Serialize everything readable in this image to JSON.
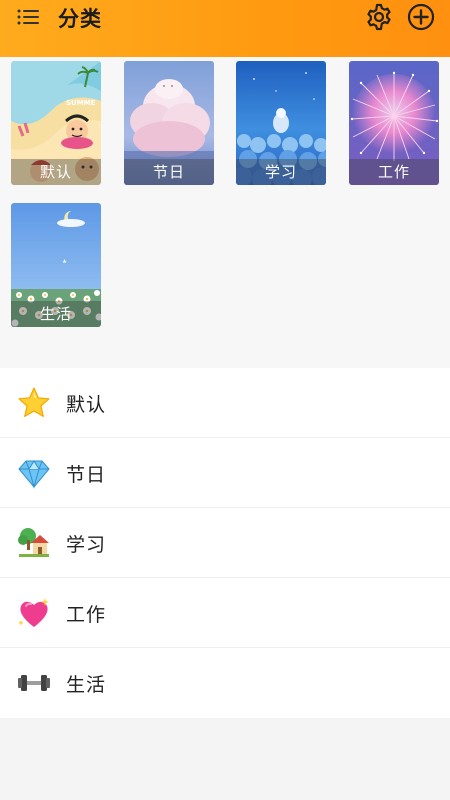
{
  "header": {
    "title": "分类",
    "menu_icon": "list-menu-icon",
    "settings_icon": "gear-icon",
    "add_icon": "plus-circle-icon",
    "background": "#ff9f14"
  },
  "categories": [
    {
      "name": "默认",
      "cover": "summer-beach-cartoon"
    },
    {
      "name": "节日",
      "cover": "pink-clouds-sky"
    },
    {
      "name": "学习",
      "cover": "blue-flowers-night"
    },
    {
      "name": "工作",
      "cover": "fireworks-purple"
    },
    {
      "name": "生活",
      "cover": "moon-daisy-field"
    }
  ],
  "list": [
    {
      "label": "默认",
      "icon": "star-icon"
    },
    {
      "label": "节日",
      "icon": "diamond-icon"
    },
    {
      "label": "学习",
      "icon": "house-with-tree-icon"
    },
    {
      "label": "工作",
      "icon": "sparkling-heart-icon"
    },
    {
      "label": "生活",
      "icon": "dumbbell-icon"
    }
  ]
}
